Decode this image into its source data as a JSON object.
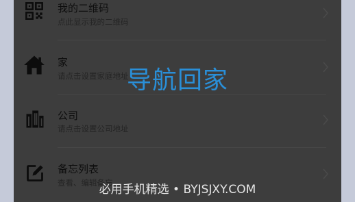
{
  "overlay": {
    "title": "导航回家",
    "title_color": "#2a8fd8"
  },
  "list": {
    "items": [
      {
        "title": "我的二维码",
        "subtitle": "点此显示我的二维码",
        "icon": "qr-code-icon"
      },
      {
        "title": "家",
        "subtitle": "请点击设置家庭地址",
        "icon": "home-icon"
      },
      {
        "title": "公司",
        "subtitle": "请点击设置公司地址",
        "icon": "building-icon"
      },
      {
        "title": "备忘列表",
        "subtitle": "查看、编辑备忘",
        "icon": "edit-note-icon"
      }
    ]
  },
  "watermark": {
    "text": "必用手机精选 • BYJSJXY.COM"
  }
}
